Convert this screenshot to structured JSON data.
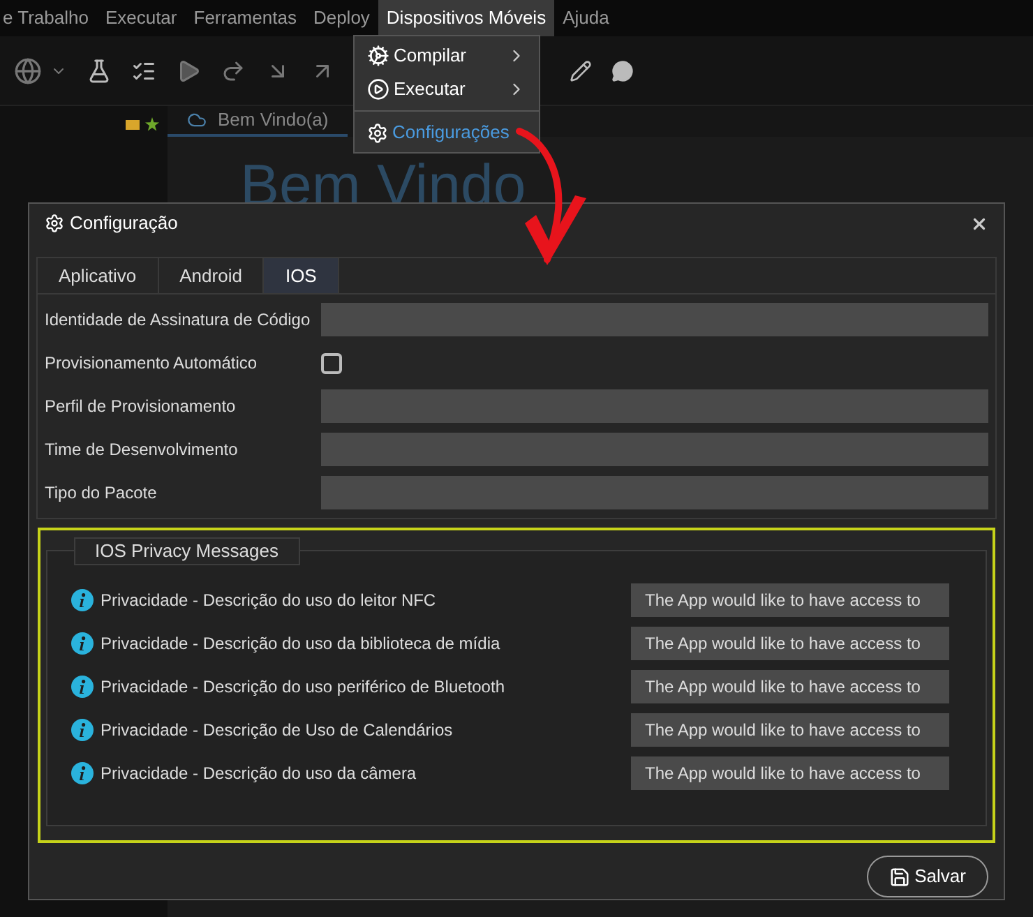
{
  "menu_bar": [
    {
      "label": "e Trabalho",
      "selected": false
    },
    {
      "label": "Executar",
      "selected": false
    },
    {
      "label": "Ferramentas",
      "selected": false
    },
    {
      "label": "Deploy",
      "selected": false
    },
    {
      "label": "Dispositivos Móveis",
      "selected": true
    },
    {
      "label": "Ajuda",
      "selected": false
    }
  ],
  "dropdown": [
    {
      "kind": "compile",
      "label": "Compilar",
      "has_submenu": true,
      "selected": false
    },
    {
      "kind": "run",
      "label": "Executar",
      "has_submenu": true,
      "selected": false
    },
    {
      "kind": "settings",
      "label": "Configurações",
      "has_submenu": false,
      "selected": true
    }
  ],
  "editor_tab": {
    "label": "Bem Vindo(a)"
  },
  "heading": "Bem Vindo",
  "dialog": {
    "title": "Configuração",
    "tabs": [
      {
        "label": "Aplicativo",
        "selected": false
      },
      {
        "label": "Android",
        "selected": false
      },
      {
        "label": "IOS",
        "selected": true
      }
    ],
    "fields": [
      {
        "kind": "text",
        "label": "Identidade de Assinatura de Código"
      },
      {
        "kind": "checkbox",
        "label": "Provisionamento Automático",
        "checked": false
      },
      {
        "kind": "text",
        "label": "Perfil de Provisionamento"
      },
      {
        "kind": "text",
        "label": "Time de Desenvolvimento"
      },
      {
        "kind": "text",
        "label": "Tipo do Pacote"
      }
    ],
    "privacy": {
      "legend": "IOS Privacy Messages",
      "rows": [
        {
          "label": "Privacidade - Descrição do uso do leitor NFC",
          "value": "The App would like to have access to"
        },
        {
          "label": "Privacidade - Descrição do uso da biblioteca de mídia",
          "value": "The App would like to have access to"
        },
        {
          "label": "Privacidade - Descrição do uso periférico de Bluetooth",
          "value": "The App would like to have access to"
        },
        {
          "label": "Privacidade - Descrição de Uso de Calendários",
          "value": "The App would like to have access to"
        },
        {
          "label": "Privacidade - Descrição do uso da câmera",
          "value": "The App would like to have access to"
        }
      ]
    },
    "save_button": "Salvar"
  }
}
